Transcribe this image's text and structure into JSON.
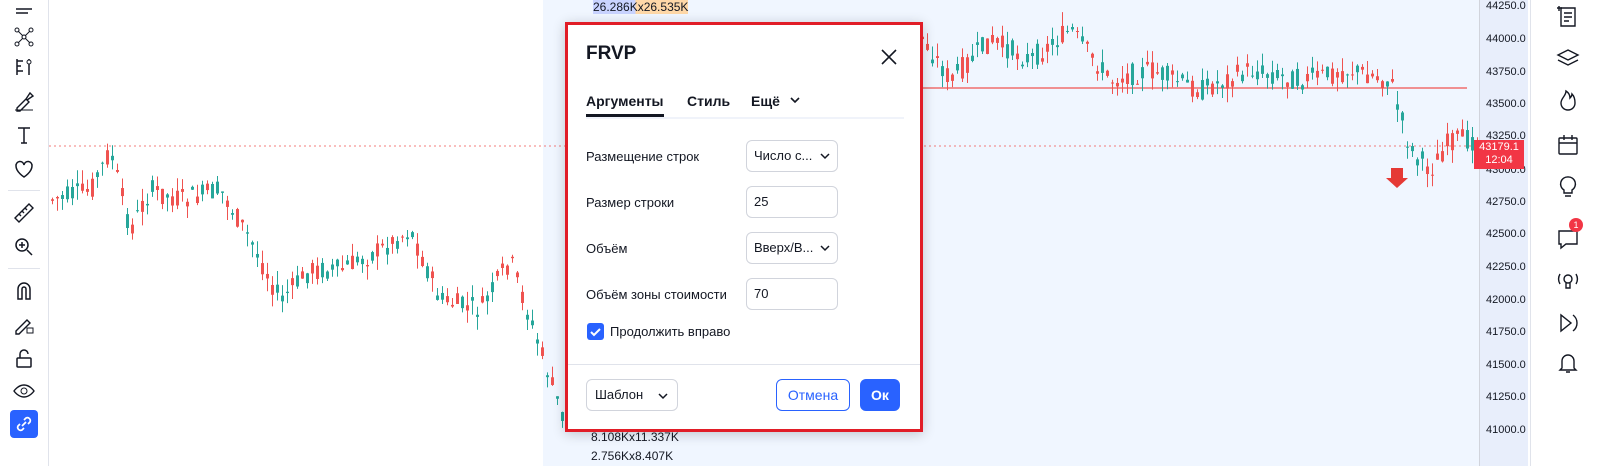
{
  "left_toolbar": {
    "icons": [
      "lines-icon",
      "pattern-icon",
      "fib-icon",
      "brush-icon",
      "text-icon",
      "heart-icon",
      "ruler-icon",
      "zoom-in-icon",
      "magnet-icon",
      "lock-pencil-icon",
      "unlock-icon",
      "eye-icon",
      "link-icon"
    ]
  },
  "chart": {
    "volume_labels": [
      "26.286Kx26.535K",
      "8.108Kx11.337K",
      "2.756Kx8.407K"
    ],
    "price_ticks": [
      "44250.0",
      "44000.0",
      "43750.0",
      "43500.0",
      "43250.0",
      "43000.0",
      "42750.0",
      "42500.0",
      "42250.0",
      "42000.0",
      "41750.0",
      "41500.0",
      "41250.0",
      "41000.0"
    ],
    "last_price": "43179.1",
    "countdown": "12:04",
    "colors": {
      "up": "#26a69a",
      "down": "#ef5350",
      "axis_highlight": "#e8eefb",
      "price_line": "#ef5350"
    }
  },
  "dialog": {
    "title": "FRVP",
    "tabs": [
      {
        "label": "Аргументы",
        "active": true
      },
      {
        "label": "Стиль",
        "active": false
      },
      {
        "label": "Ещё",
        "active": false
      }
    ],
    "fields": {
      "row_layout": {
        "label": "Размещение строк",
        "value": "Число с..."
      },
      "row_size": {
        "label": "Размер строки",
        "value": "25"
      },
      "volume": {
        "label": "Объём",
        "value": "Вверх/В..."
      },
      "value_area_volume": {
        "label": "Объём зоны стоимости",
        "value": "70"
      }
    },
    "extend_right": {
      "label": "Продолжить вправо",
      "checked": true
    },
    "footer": {
      "template": "Шаблон",
      "cancel": "Отмена",
      "ok": "Ок"
    },
    "accent_color": "#2962ff",
    "frame_color": "#e11d27"
  },
  "right_toolbar": {
    "icons": [
      "watchlist-icon",
      "layers-icon",
      "hotlist-icon",
      "calendar-icon",
      "ideas-icon",
      "chat-icon",
      "streams-icon",
      "replay-icon",
      "alerts-icon"
    ],
    "chat_badge": "1"
  }
}
